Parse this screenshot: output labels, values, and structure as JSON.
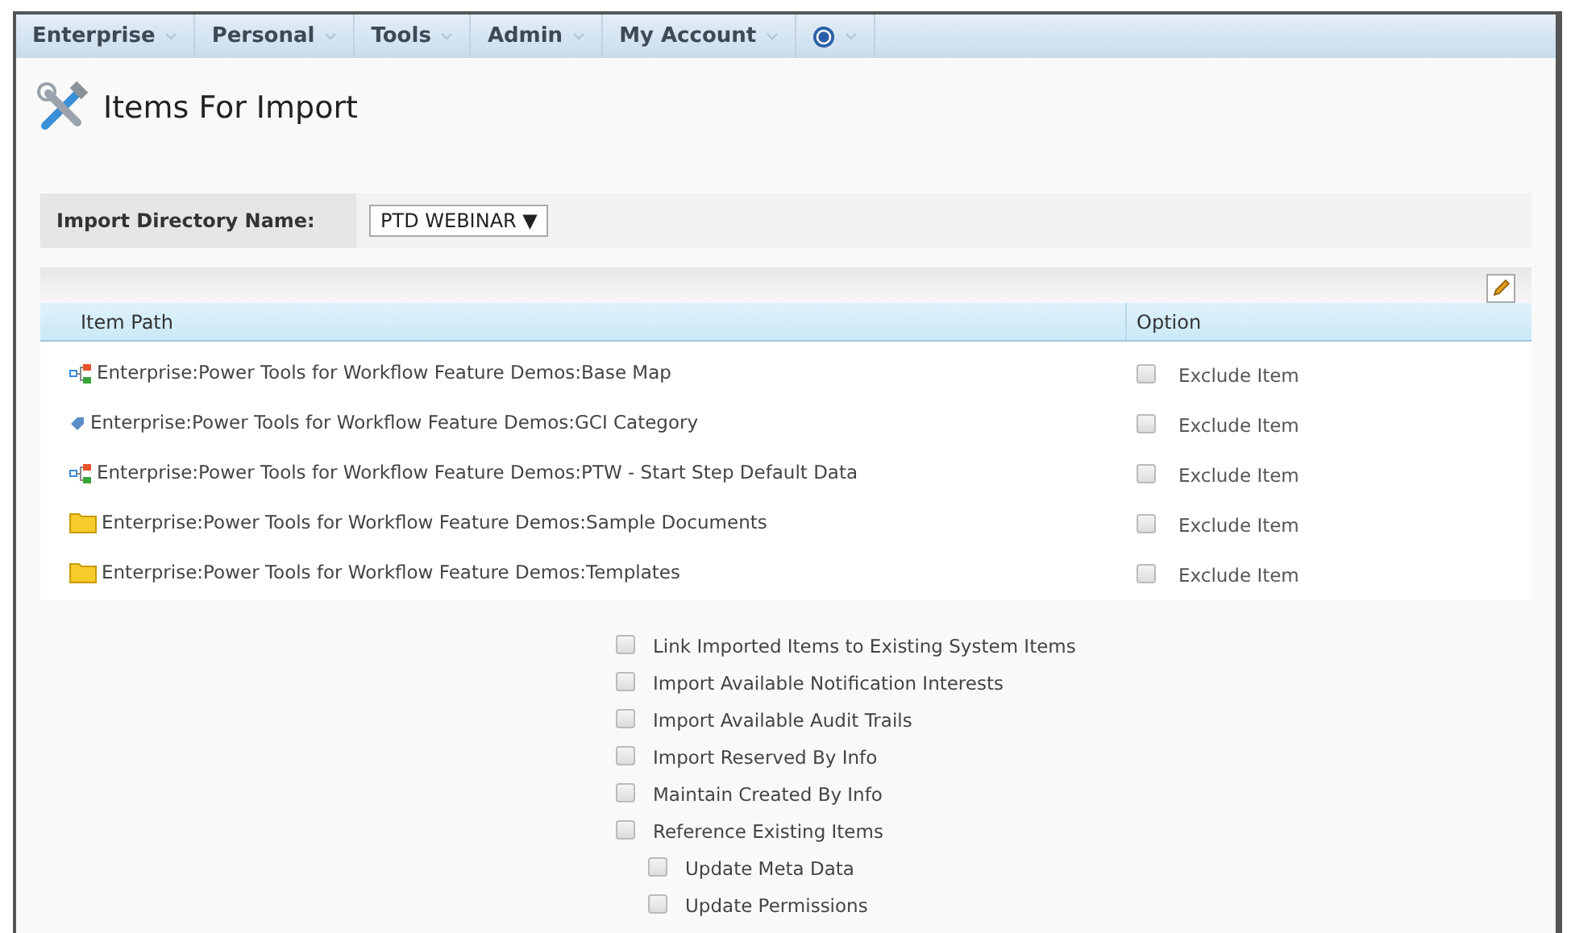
{
  "menu": [
    {
      "label": "Enterprise",
      "kind": "text"
    },
    {
      "label": "Personal",
      "kind": "text"
    },
    {
      "label": "Tools",
      "kind": "text"
    },
    {
      "label": "Admin",
      "kind": "text"
    },
    {
      "label": "My Account",
      "kind": "text"
    },
    {
      "kind": "help"
    }
  ],
  "page": {
    "title": "Items For Import"
  },
  "directory": {
    "label": "Import Directory Name:",
    "value": "PTD WEBINAR",
    "arrow": "▼"
  },
  "table": {
    "columns": [
      "Item Path",
      "Option"
    ],
    "rows": [
      {
        "kind": "workflow",
        "path": "Enterprise:Power Tools for Workflow Feature Demos:Base Map",
        "option": "Exclude Item",
        "checked": false
      },
      {
        "kind": "category",
        "path": "Enterprise:Power Tools for Workflow Feature Demos:GCI Category",
        "option": "Exclude Item",
        "checked": false
      },
      {
        "kind": "workflow",
        "path": "Enterprise:Power Tools for Workflow Feature Demos:PTW - Start Step Default Data",
        "option": "Exclude Item",
        "checked": false
      },
      {
        "kind": "folder",
        "path": "Enterprise:Power Tools for Workflow Feature Demos:Sample Documents",
        "option": "Exclude Item",
        "checked": false
      },
      {
        "kind": "folder",
        "path": "Enterprise:Power Tools for Workflow Feature Demos:Templates",
        "option": "Exclude Item",
        "checked": false
      }
    ]
  },
  "options": [
    {
      "label": "Link Imported Items to Existing System Items",
      "checked": false
    },
    {
      "label": "Import Available Notification Interests",
      "checked": false
    },
    {
      "label": "Import Available Audit Trails",
      "checked": false
    },
    {
      "label": "Import Reserved By Info",
      "checked": false
    },
    {
      "label": "Maintain Created By Info",
      "checked": false
    },
    {
      "label": "Reference Existing Items",
      "checked": false,
      "children": [
        {
          "label": "Update Meta Data",
          "checked": false
        },
        {
          "label": "Update Permissions",
          "checked": false
        }
      ]
    }
  ]
}
